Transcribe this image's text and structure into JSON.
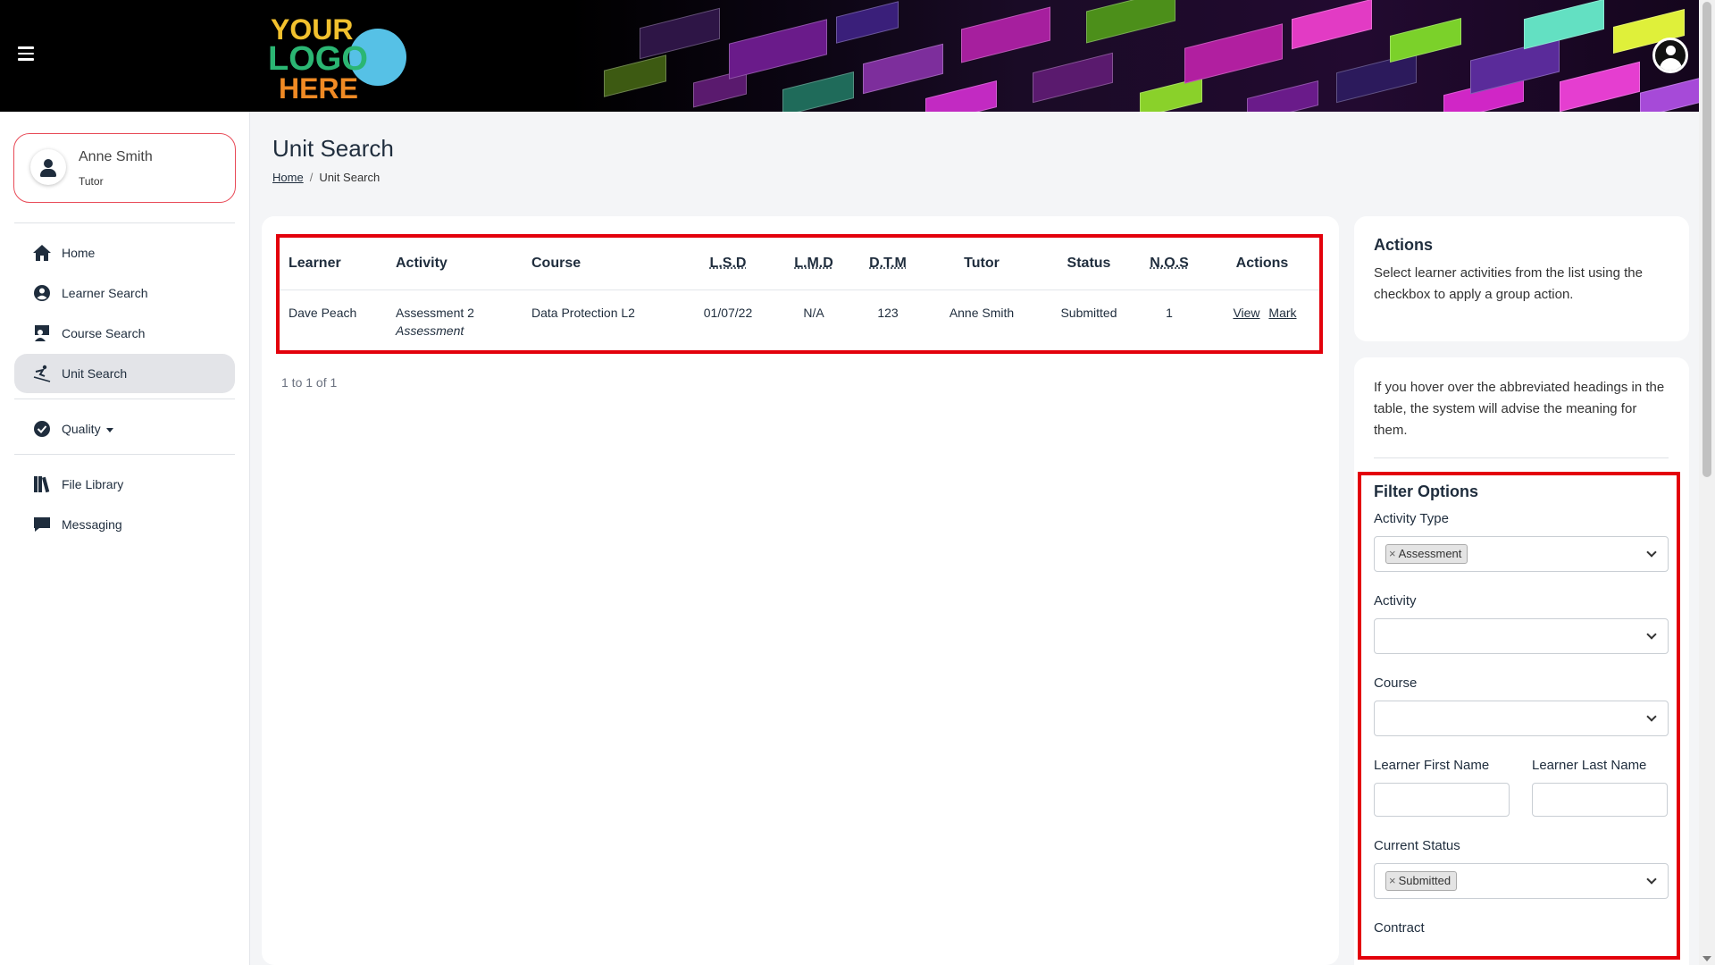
{
  "header": {
    "logo_lines": [
      "YOUR",
      "LOGO",
      "HERE"
    ]
  },
  "user": {
    "name": "Anne Smith",
    "role": "Tutor"
  },
  "nav": {
    "home": "Home",
    "learner_search": "Learner Search",
    "course_search": "Course Search",
    "unit_search": "Unit Search",
    "quality": "Quality",
    "file_library": "File Library",
    "messaging": "Messaging"
  },
  "page": {
    "title": "Unit Search",
    "breadcrumb_home": "Home",
    "breadcrumb_current": "Unit Search"
  },
  "table": {
    "headers": {
      "learner": "Learner",
      "activity": "Activity",
      "course": "Course",
      "lsd": "L.S.D",
      "lmd": "L.M.D",
      "dtm": "D.T.M",
      "tutor": "Tutor",
      "status": "Status",
      "nos": "N.O.S",
      "actions": "Actions"
    },
    "rows": [
      {
        "learner": "Dave Peach",
        "activity": "Assessment 2",
        "activity_type": "Assessment",
        "course": "Data Protection L2",
        "lsd": "01/07/22",
        "lmd": "N/A",
        "dtm": "123",
        "tutor": "Anne Smith",
        "status": "Submitted",
        "nos": "1",
        "view": "View",
        "mark": "Mark"
      }
    ],
    "pagination": "1 to 1 of 1"
  },
  "actions_panel": {
    "title": "Actions",
    "text": "Select learner activities from the list using the checkbox to apply a group action."
  },
  "filter": {
    "hint": "If you hover over the abbreviated headings in the table, the system will advise the meaning for them.",
    "title": "Filter Options",
    "activity_type_label": "Activity Type",
    "activity_type_chip": "Assessment",
    "activity_label": "Activity",
    "course_label": "Course",
    "first_name_label": "Learner First Name",
    "last_name_label": "Learner Last Name",
    "current_status_label": "Current Status",
    "current_status_chip": "Submitted",
    "contract_label": "Contract"
  },
  "colors": {
    "highlight": "#e3000b",
    "text": "#1f2d3d",
    "logo_yellow": "#f2c12e",
    "logo_green": "#2bb673",
    "logo_orange": "#f08a24",
    "logo_blue": "#56c1e6"
  }
}
